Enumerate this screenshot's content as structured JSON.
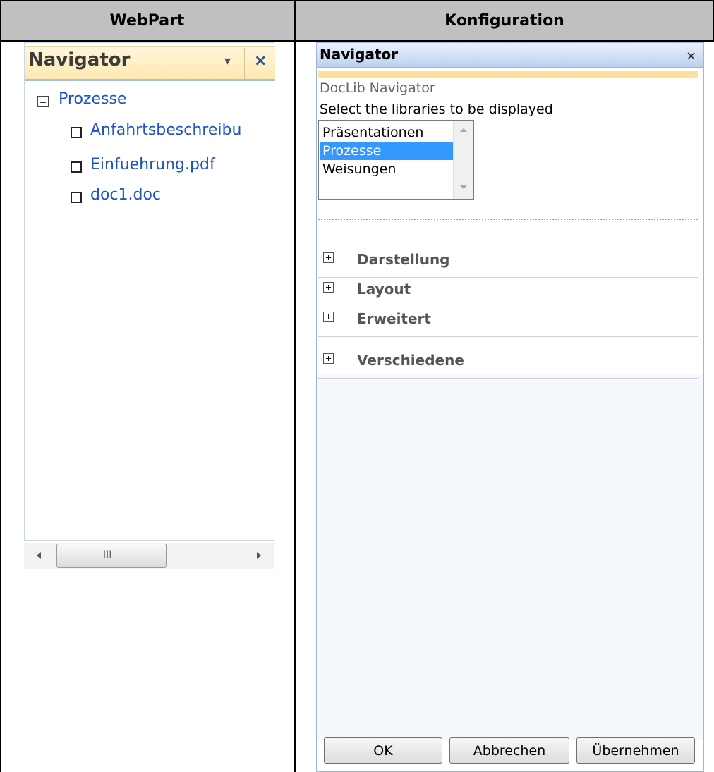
{
  "table": {
    "headers": [
      "WebPart",
      "Konfiguration"
    ]
  },
  "webpart": {
    "title": "Navigator",
    "menu_glyph": "▾",
    "close_glyph": "×",
    "tree": {
      "root": "Prozesse",
      "children": [
        "Anfahrtsbeschreibu",
        "Einfuehrung.pdf",
        "doc1.doc"
      ]
    },
    "scrollbar": {
      "grip": "III"
    }
  },
  "config": {
    "title": "Navigator",
    "close_glyph": "×",
    "subtitle": "DocLib Navigator",
    "select_label": "Select the libraries to be displayed",
    "libraries": [
      "Präsentationen",
      "Prozesse",
      "Weisungen"
    ],
    "selected_library": "Prozesse",
    "sections": [
      "Darstellung",
      "Layout",
      "Erweitert",
      "Verschiedene"
    ],
    "buttons": {
      "ok": "OK",
      "cancel": "Abbrechen",
      "apply": "Übernehmen"
    }
  },
  "colors": {
    "link": "#1f54c2",
    "selection": "#3399ff",
    "header_gray": "#c0c0c0",
    "header_yellow": "#fde29e"
  }
}
